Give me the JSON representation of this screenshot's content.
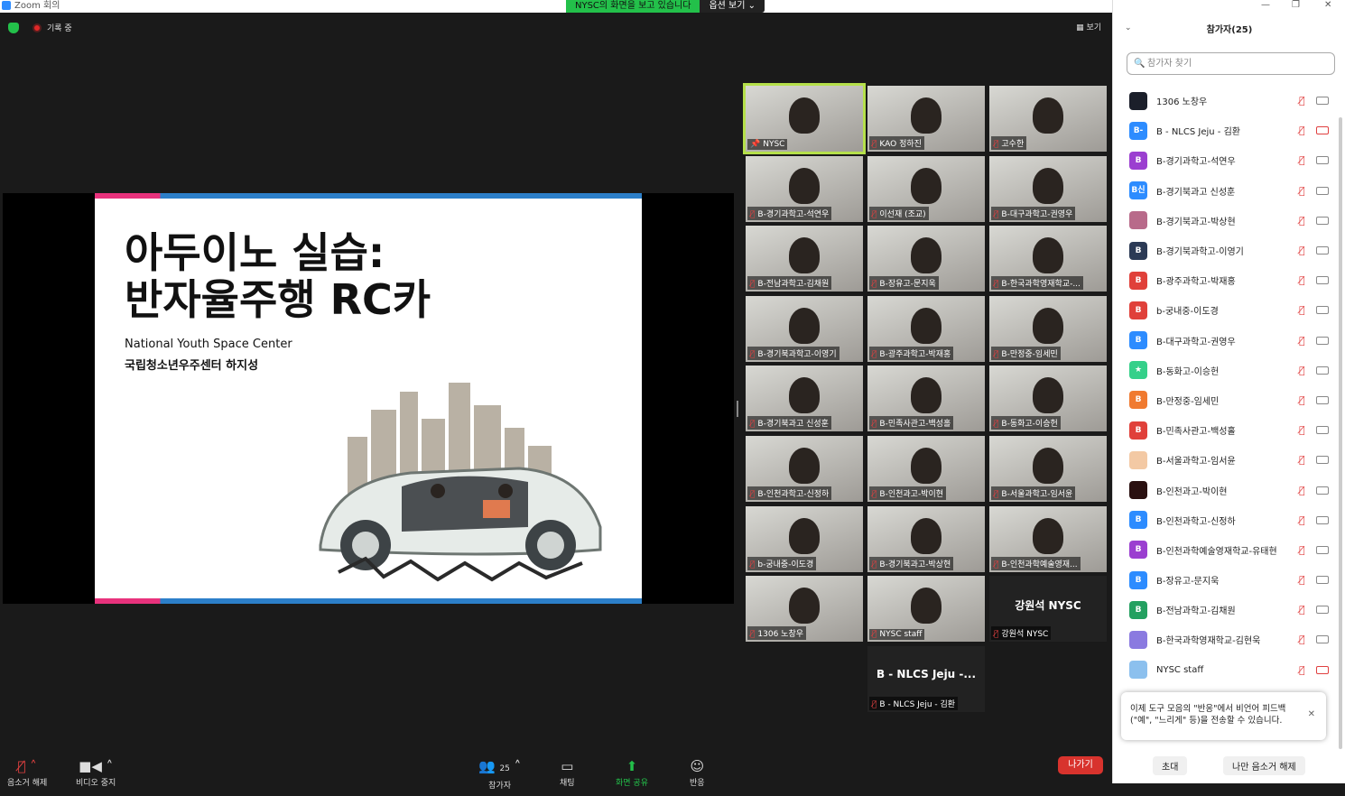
{
  "window": {
    "title": "Zoom 회의"
  },
  "share_banner": {
    "text": "NYSC의 화면을 보고 있습니다",
    "options": "옵션 보기 ⌄"
  },
  "top": {
    "recording": "기록 중",
    "view": "보기"
  },
  "slide": {
    "title": "아두이노 실습:\n반자율주행 RC카",
    "subtitle_en": "National Youth Space Center",
    "subtitle_ko": "국립청소년우주센터 하지성"
  },
  "tiles": [
    {
      "name": "NYSC",
      "muted": false,
      "pinned": true
    },
    {
      "name": "KAO 정하진",
      "muted": true
    },
    {
      "name": "고수한",
      "muted": true
    },
    {
      "name": "B-경기과학고-석연우",
      "muted": true
    },
    {
      "name": "이선재 (조교)",
      "muted": true
    },
    {
      "name": "B-대구과학고-권영우",
      "muted": true
    },
    {
      "name": "B-전남과학고-김채원",
      "muted": true
    },
    {
      "name": "B-장유고-문지욱",
      "muted": true
    },
    {
      "name": "B-한국과학영재학교-...",
      "muted": true
    },
    {
      "name": "B-경기북과학고-이영기",
      "muted": true
    },
    {
      "name": "B-광주과학고-박재홍",
      "muted": true
    },
    {
      "name": "B-만정중-임세민",
      "muted": true
    },
    {
      "name": "B-경기북과고 신성훈",
      "muted": true
    },
    {
      "name": "B-민족사관고-백성홀",
      "muted": true
    },
    {
      "name": "B-동화고-이승헌",
      "muted": true
    },
    {
      "name": "B-인천과학고-신정하",
      "muted": true
    },
    {
      "name": "B-인천과고-박이현",
      "muted": true
    },
    {
      "name": "B-서울과학고-임서윤",
      "muted": true
    },
    {
      "name": "b-궁내중-이도경",
      "muted": true
    },
    {
      "name": "B-경기북과고-박상현",
      "muted": true
    },
    {
      "name": "B-인천과학예술영재...",
      "muted": true
    },
    {
      "name": "1306 노창우",
      "muted": true
    },
    {
      "name": "NYSC staff",
      "muted": true
    },
    {
      "name": "강원석 NYSC",
      "muted": true,
      "big": "강원석 NYSC"
    },
    {
      "name": "B - NLCS Jeju - 김환",
      "muted": true,
      "big": "B - NLCS Jeju -..."
    }
  ],
  "toolbar": {
    "audio": "음소거 해제",
    "video": "비디오 중지",
    "participants": "참가자",
    "participants_count": "25",
    "chat": "채팅",
    "share": "화면 공유",
    "reactions": "반응",
    "leave": "나가기"
  },
  "panel": {
    "title": "참가자(25)",
    "search_placeholder": "참가자 찾기",
    "participants": [
      {
        "avatar": "",
        "color": "#1b1f2a",
        "name": "1306 노창우",
        "cam_off": false
      },
      {
        "avatar": "B-",
        "color": "#2d8cff",
        "name": "B - NLCS Jeju - 김환",
        "cam_off": true
      },
      {
        "avatar": "B",
        "color": "#9b3fd0",
        "name": "B-경기과학고-석연우",
        "cam_off": false
      },
      {
        "avatar": "B신",
        "color": "#2d8cff",
        "name": "B-경기북과고 신성훈",
        "cam_off": false
      },
      {
        "avatar": "",
        "color": "#b86a8a",
        "name": "B-경기북과고-박상현",
        "cam_off": false
      },
      {
        "avatar": "B",
        "color": "#2b3a55",
        "name": "B-경기북과학고-이영기",
        "cam_off": false
      },
      {
        "avatar": "B",
        "color": "#e0403a",
        "name": "B-광주과학고-박재홍",
        "cam_off": false
      },
      {
        "avatar": "B",
        "color": "#e0403a",
        "name": "b-궁내중-이도경",
        "cam_off": false
      },
      {
        "avatar": "B",
        "color": "#2d8cff",
        "name": "B-대구과학고-권영우",
        "cam_off": false
      },
      {
        "avatar": "★",
        "color": "#35d08a",
        "name": "B-동화고-이승헌",
        "cam_off": false
      },
      {
        "avatar": "B",
        "color": "#f07a30",
        "name": "B-만정중-임세민",
        "cam_off": false
      },
      {
        "avatar": "B",
        "color": "#e0403a",
        "name": "B-민족사관고-백성홀",
        "cam_off": false
      },
      {
        "avatar": "",
        "color": "#f3c9a4",
        "name": "B-서울과학고-임서윤",
        "cam_off": false
      },
      {
        "avatar": "",
        "color": "#2a1010",
        "name": "B-인천과고-박이현",
        "cam_off": false
      },
      {
        "avatar": "B",
        "color": "#2d8cff",
        "name": "B-인천과학고-신정하",
        "cam_off": false
      },
      {
        "avatar": "B",
        "color": "#9b3fd0",
        "name": "B-인천과학예술영재학교-유태현",
        "cam_off": false
      },
      {
        "avatar": "B",
        "color": "#2d8cff",
        "name": "B-장유고-문지욱",
        "cam_off": false
      },
      {
        "avatar": "B",
        "color": "#23a060",
        "name": "B-전남과학고-김채원",
        "cam_off": false
      },
      {
        "avatar": "",
        "color": "#8a7ae0",
        "name": "B-한국과학영재학교-김현욱",
        "cam_off": false
      },
      {
        "avatar": "",
        "color": "#8cc0ee",
        "name": "NYSC staff",
        "cam_off": true
      }
    ],
    "tip": "이제 도구 모음의 \"반응\"에서 비언어 피드백(\"예\", \"느리게\" 등)을 전송할 수 있습니다.",
    "invite": "초대",
    "unmute_me": "나만 음소거 해제"
  },
  "colors": {
    "accent": "#2d8cff",
    "green": "#23c04a",
    "leave": "#d8332d",
    "muted": "#e04040"
  }
}
